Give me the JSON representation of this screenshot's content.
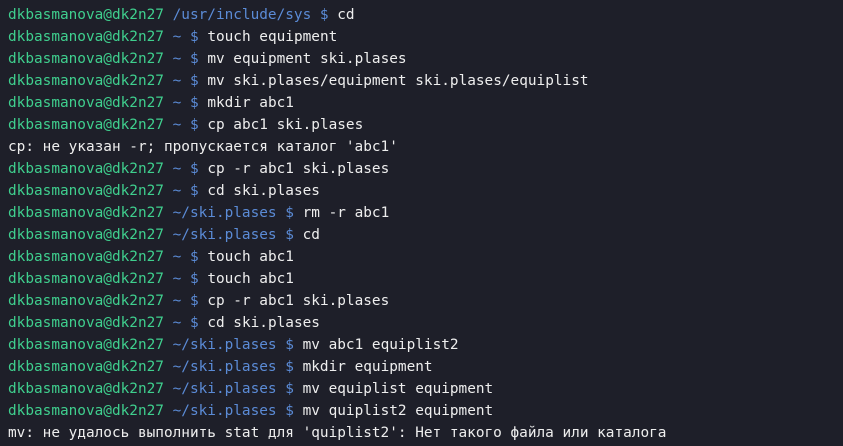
{
  "terminal": {
    "lines": [
      {
        "type": "prompt",
        "user": "dkbasmanova@dk2n27",
        "path": "/usr/include/sys",
        "symbol": "$",
        "command": "cd"
      },
      {
        "type": "prompt",
        "user": "dkbasmanova@dk2n27",
        "path": "~",
        "symbol": "$",
        "command": "touch equipment"
      },
      {
        "type": "prompt",
        "user": "dkbasmanova@dk2n27",
        "path": "~",
        "symbol": "$",
        "command": "mv equipment ski.plases"
      },
      {
        "type": "prompt",
        "user": "dkbasmanova@dk2n27",
        "path": "~",
        "symbol": "$",
        "command": "mv ski.plases/equipment ski.plases/equiplist"
      },
      {
        "type": "prompt",
        "user": "dkbasmanova@dk2n27",
        "path": "~",
        "symbol": "$",
        "command": "mkdir abc1"
      },
      {
        "type": "prompt",
        "user": "dkbasmanova@dk2n27",
        "path": "~",
        "symbol": "$",
        "command": "cp abc1 ski.plases"
      },
      {
        "type": "output",
        "text": "cp: не указан -r; пропускается каталог 'abc1'"
      },
      {
        "type": "prompt",
        "user": "dkbasmanova@dk2n27",
        "path": "~",
        "symbol": "$",
        "command": "cp -r abc1 ski.plases"
      },
      {
        "type": "prompt",
        "user": "dkbasmanova@dk2n27",
        "path": "~",
        "symbol": "$",
        "command": "cd ski.plases"
      },
      {
        "type": "prompt",
        "user": "dkbasmanova@dk2n27",
        "path": "~/ski.plases",
        "symbol": "$",
        "command": "rm -r abc1"
      },
      {
        "type": "prompt",
        "user": "dkbasmanova@dk2n27",
        "path": "~/ski.plases",
        "symbol": "$",
        "command": "cd"
      },
      {
        "type": "prompt",
        "user": "dkbasmanova@dk2n27",
        "path": "~",
        "symbol": "$",
        "command": "touch abc1"
      },
      {
        "type": "prompt",
        "user": "dkbasmanova@dk2n27",
        "path": "~",
        "symbol": "$",
        "command": "touch abc1"
      },
      {
        "type": "prompt",
        "user": "dkbasmanova@dk2n27",
        "path": "~",
        "symbol": "$",
        "command": "cp -r abc1 ski.plases"
      },
      {
        "type": "prompt",
        "user": "dkbasmanova@dk2n27",
        "path": "~",
        "symbol": "$",
        "command": "cd ski.plases"
      },
      {
        "type": "prompt",
        "user": "dkbasmanova@dk2n27",
        "path": "~/ski.plases",
        "symbol": "$",
        "command": "mv abc1 equiplist2"
      },
      {
        "type": "prompt",
        "user": "dkbasmanova@dk2n27",
        "path": "~/ski.plases",
        "symbol": "$",
        "command": "mkdir equipment"
      },
      {
        "type": "prompt",
        "user": "dkbasmanova@dk2n27",
        "path": "~/ski.plases",
        "symbol": "$",
        "command": "mv equiplist equipment"
      },
      {
        "type": "prompt",
        "user": "dkbasmanova@dk2n27",
        "path": "~/ski.plases",
        "symbol": "$",
        "command": "mv quiplist2 equipment"
      },
      {
        "type": "output",
        "text": "mv: не удалось выполнить stat для 'quiplist2': Нет такого файла или каталога"
      }
    ]
  },
  "colors": {
    "background": "#1e1f29",
    "user": "#3fcf8e",
    "path": "#5b8bd6",
    "text": "#eeeeee"
  }
}
